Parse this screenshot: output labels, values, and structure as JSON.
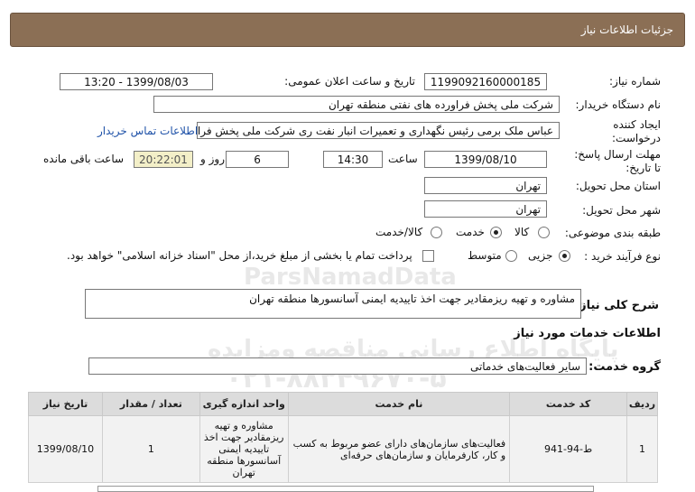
{
  "header": {
    "title": "جزئیات اطلاعات نیاز"
  },
  "fields": {
    "need_number_label": "شماره نیاز:",
    "need_number": "1199092160000185",
    "announce_label": "تاریخ و ساعت اعلان عمومی:",
    "announce_value": "1399/08/03 - 13:20",
    "buyer_org_label": "نام دستگاه خریدار:",
    "buyer_org": "شرکت ملی پخش فراورده های نفتی منطقه تهران",
    "creator_label_1": "ایجاد کننده",
    "creator_label_2": "درخواست:",
    "creator": "عباس ملک برمی رئیس نگهداری و تعمیرات انبار نفت ری شرکت ملی پخش فراورده",
    "contact_link": "اطلاعات تماس خریدار",
    "deadline_label_1": "مهلت ارسال پاسخ:",
    "deadline_label_2": "تا تاریخ:",
    "deadline_date": "1399/08/10",
    "time_label": "ساعت",
    "deadline_time": "14:30",
    "days_value": "6",
    "days_label": "روز و",
    "remaining_time": "20:22:01",
    "remaining_label": "ساعت باقی مانده",
    "province_label": "استان محل تحویل:",
    "province": "تهران",
    "city_label": "شهر محل تحویل:",
    "city": "تهران",
    "category_label": "طبقه بندی موضوعی:",
    "category_options": [
      "کالا",
      "خدمت",
      "کالا/خدمت"
    ],
    "category_selected": "خدمت",
    "process_label": "نوع فرآیند خرید :",
    "process_options": [
      "جزیی",
      "متوسط"
    ],
    "process_selected": "جزیی",
    "payment_note": "پرداخت تمام یا بخشی از مبلغ خرید،از محل \"اسناد خزانه اسلامی\" خواهد بود."
  },
  "description": {
    "label": "شرح کلی نیاز:",
    "text": "مشاوره و تهیه ریزمقادیر جهت اخذ تاییدیه ایمنی آسانسورها منطقه تهران"
  },
  "services": {
    "section_title": "اطلاعات خدمات مورد نیاز",
    "group_label": "گروه خدمت:",
    "group_value": "سایر فعالیت‌های خدماتی",
    "columns": [
      "ردیف",
      "کد خدمت",
      "نام خدمت",
      "واحد اندازه گیری",
      "تعداد / مقدار",
      "تاریخ نیاز"
    ],
    "rows": [
      {
        "index": "1",
        "code": "ط-94-941",
        "name": "فعالیت‌های سازمان‌های دارای عضو مربوط به کسب و کار، کارفرمایان و سازمان‌های حرفه‌ای",
        "unit": "مشاوره و تهیه ریزمقادیر جهت اخذ تاییدیه ایمنی آسانسورها منطقه تهران",
        "qty": "1",
        "date": "1399/08/10"
      }
    ]
  },
  "watermark": {
    "line1": "ParsNamadData",
    "line2": "مرکز فراوری اطلاعات پارس نماد داده ها",
    "line3": "پایگاه اطلاع رسانی مناقصه ومزایده",
    "line4": "۰۲۱-۸۸۳۴۹۶۷۰-۵"
  },
  "colors": {
    "title_bar": "#8b6f55",
    "remaining_bg": "#f3efc8",
    "link": "#1f52a8"
  }
}
